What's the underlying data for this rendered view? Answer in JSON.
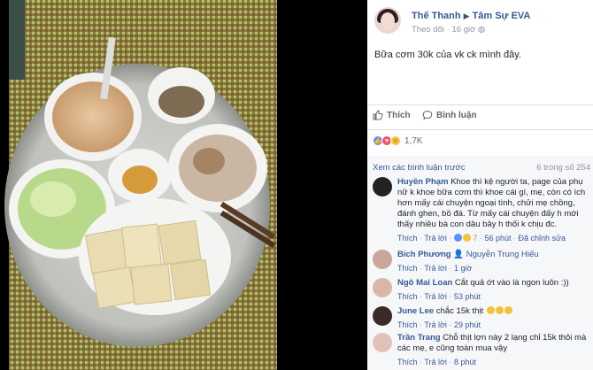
{
  "post": {
    "author": "Thế Thanh",
    "group": "Tâm Sự EVA",
    "follow_label": "Theo dõi",
    "time": "16 giờ",
    "text": "Bữa cơm 30k của vk ck mình đây.",
    "like_label": "Thích",
    "comment_label": "Bình luận",
    "reaction_count": "1,7K"
  },
  "comments_section": {
    "view_more": "Xem các bình luận trước",
    "count": "6 trong số 254",
    "like_label": "Thích",
    "reply_label": "Trả lời",
    "items": [
      {
        "name": "Huyền Phạm",
        "text": "Khoe thì kệ người ta, page của phụ nữ k khoe bữa cơm thì khoe cái gì, mẹ, còn có ích hơn mấy cái chuyện ngoại tình, chửi mẹ chồng, đánh ghen, bồ đá. Từ mấy cái chuyện đấy h mới thấy nhiều bà con dâu bây h thối k chịu đc.",
        "reactions": "7",
        "time": "56 phút",
        "extra": "Đã chỉnh sửa"
      },
      {
        "name": "Bích Phương",
        "text": "Nguyễn Trung Hiếu",
        "time": "1 giờ"
      },
      {
        "name": "Ngô Mai Loan",
        "text": "Cắt quả ớt vào là ngon luôn :))",
        "time": "53 phút"
      },
      {
        "name": "June Lee",
        "text": "chắc 15k thịt",
        "time": "29 phút"
      },
      {
        "name": "Trần Trang",
        "text": "Chỗ thịt lợn này 2 lạng chỉ 15k thôi mà các mẹ, e cũng toàn mua vậy",
        "time": "8 phút"
      }
    ]
  },
  "colors": {
    "link": "#365899",
    "like_blue": "#5890ff",
    "love_red": "#f25268",
    "haha_yellow": "#f5c33b"
  }
}
